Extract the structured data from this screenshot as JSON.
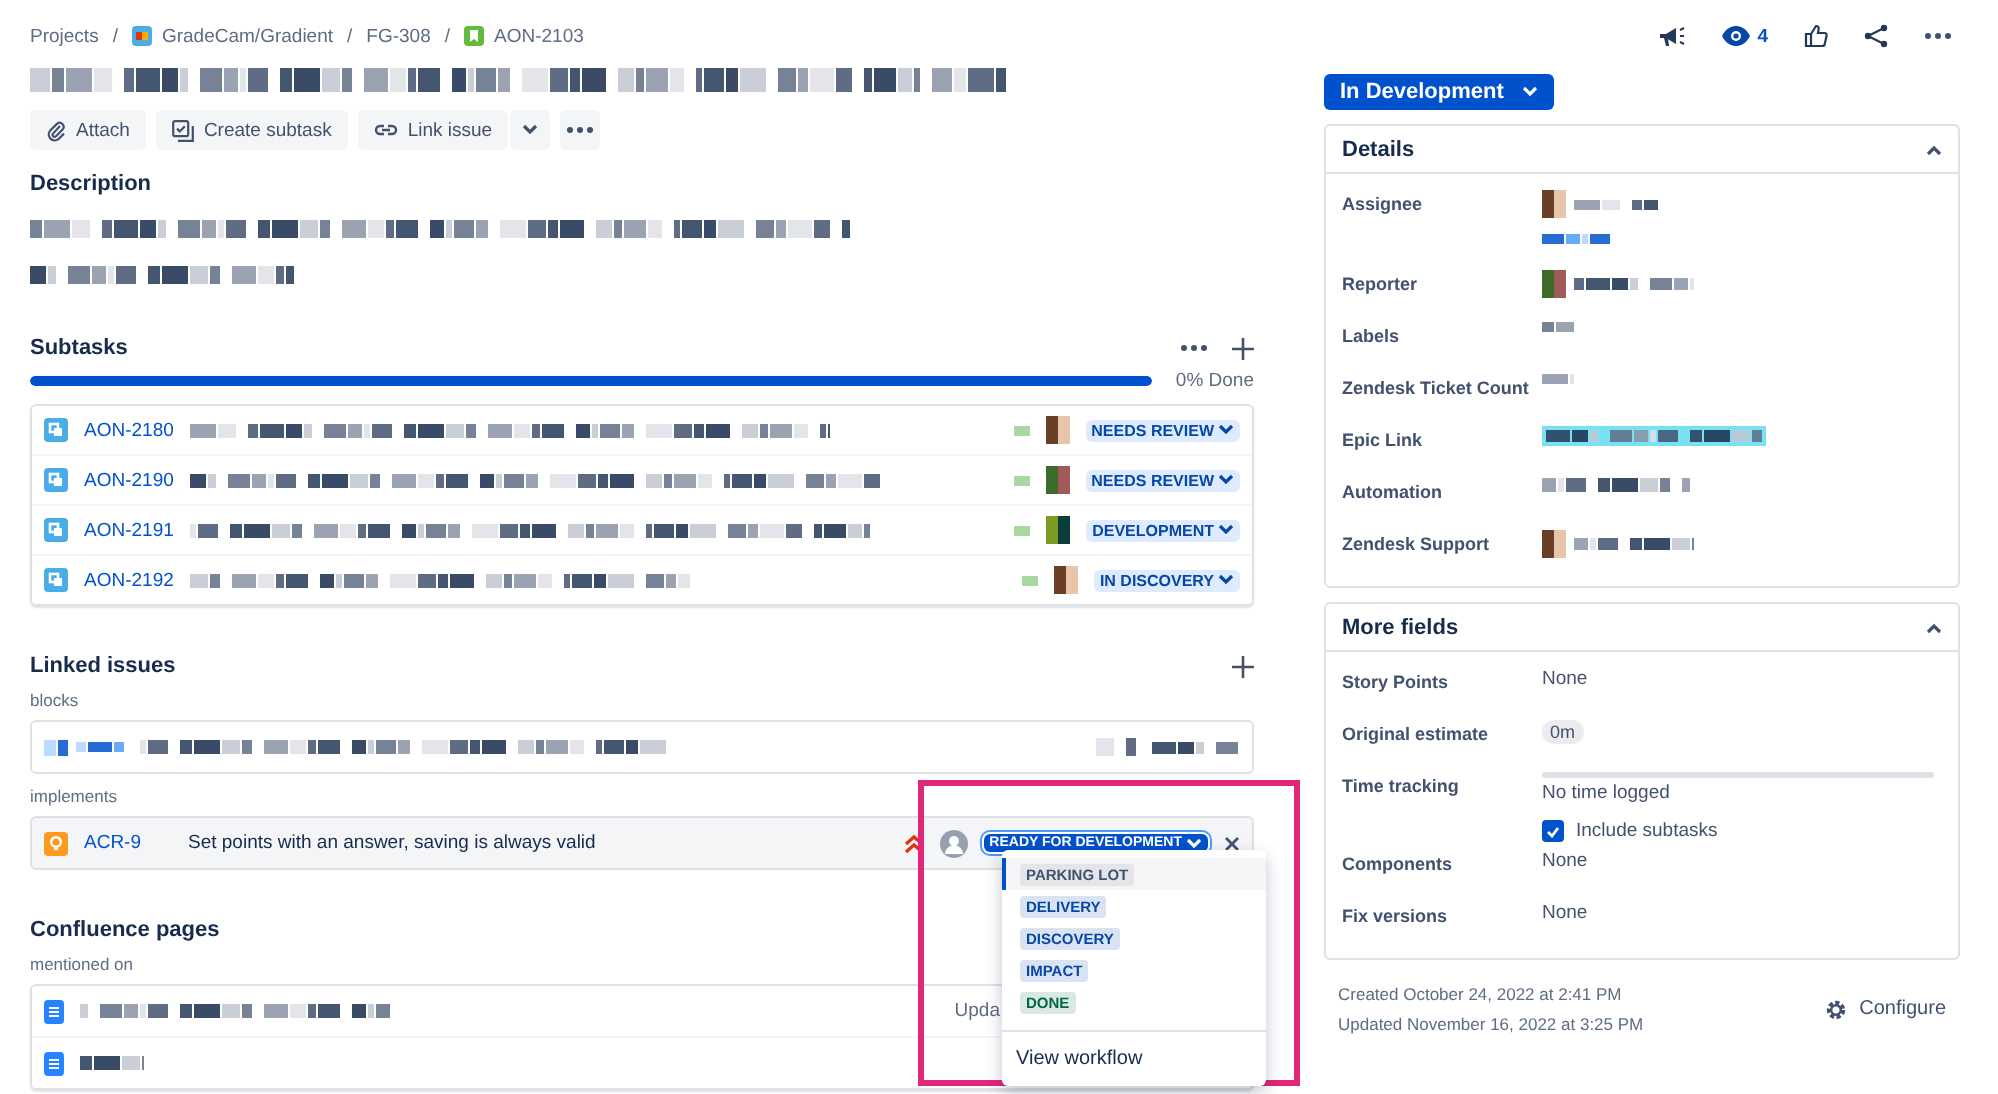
{
  "breadcrumbs": [
    {
      "label": "Projects",
      "kind": "text"
    },
    {
      "separator": "/",
      "label": "GradeCam/Gradient",
      "kind": "project"
    },
    {
      "separator": "/",
      "label": "FG-308",
      "kind": "text"
    },
    {
      "separator": "/",
      "label": "AON-2103",
      "kind": "issue"
    }
  ],
  "toolbar": [
    {
      "label": "Attach",
      "kind": "attach"
    },
    {
      "label": "Create subtask",
      "kind": "subtask"
    },
    {
      "label": "Link issue",
      "kind": "link"
    }
  ],
  "description": {
    "title": "Description"
  },
  "subtasks": {
    "title": "Subtasks",
    "level": 1,
    "progress": "0% Done",
    "rows": [
      {
        "key": "AON-2180",
        "status": "NEEDS REVIEW"
      },
      {
        "key": "AON-2190",
        "status": "NEEDS REVIEW"
      },
      {
        "key": "AON-2191",
        "status": "DEVELOPMENT"
      },
      {
        "key": "AON-2192",
        "status": "IN DISCOVERY"
      }
    ]
  },
  "linked_issues": {
    "title": "Linked issues",
    "groups": [
      {
        "label": "blocks",
        "kind": "redacted"
      },
      {
        "label": "implements",
        "kind": "issue",
        "key": "ACR-9",
        "summary": "Set points with an answer, saving is always valid",
        "status": "READY FOR DEVELOPMENT"
      }
    ]
  },
  "status_menu": {
    "options": [
      {
        "label": "PARKING LOT",
        "color": "#42526e",
        "selected": true
      },
      {
        "label": "DELIVERY",
        "color": "#0747a6",
        "selected": false
      },
      {
        "label": "DISCOVERY",
        "color": "#0747a6",
        "selected": false
      },
      {
        "label": "IMPACT",
        "color": "#0747a6",
        "selected": false
      },
      {
        "label": "DONE",
        "color": "#006644",
        "selected": false
      }
    ],
    "footer": "View workflow"
  },
  "confluence": {
    "title": "Confluence pages",
    "subtitle": "mentioned on",
    "rows": [
      {
        "meta": "Upda"
      },
      {
        "meta": ""
      }
    ]
  },
  "header_actions": {
    "watchers": "4"
  },
  "status_button": {
    "label": "In Development"
  },
  "details": {
    "title": "Details",
    "expanded": true,
    "fields": [
      {
        "label": "Assignee",
        "kind": "person2"
      },
      {
        "label": "Reporter",
        "kind": "person"
      },
      {
        "label": "Labels",
        "kind": "short"
      },
      {
        "label": "Zendesk Ticket Count",
        "kind": "short"
      },
      {
        "label": "Epic Link",
        "kind": "epic"
      },
      {
        "label": "Automation",
        "kind": "long"
      },
      {
        "label": "Zendesk Support",
        "kind": "person"
      }
    ]
  },
  "more_fields": {
    "title": "More fields",
    "expanded": true,
    "fields": [
      {
        "label": "Story Points",
        "kind": "text",
        "value": "None"
      },
      {
        "label": "Original estimate",
        "kind": "tag",
        "value": "0m"
      },
      {
        "label": "Time tracking",
        "kind": "tracking",
        "value": "No time logged",
        "checkbox": {
          "label": "Include subtasks",
          "checked": true
        }
      },
      {
        "label": "Components",
        "kind": "text",
        "value": "None"
      },
      {
        "label": "Fix versions",
        "kind": "text",
        "value": "None"
      }
    ]
  },
  "footer": {
    "created": "Created October 24, 2022 at 2:41 PM",
    "updated": "Updated November 16, 2022 at 3:25 PM",
    "configure": "Configure"
  }
}
